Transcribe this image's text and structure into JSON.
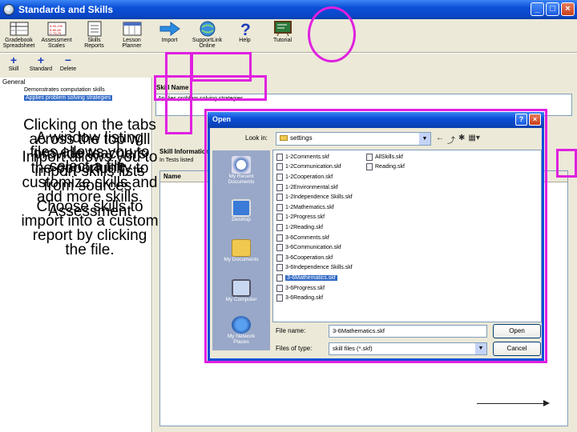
{
  "window": {
    "title": "Standards and Skills",
    "min": "_",
    "max": "□",
    "close": "×"
  },
  "toolbar": [
    {
      "label": "Gradebook\nSpreadsheet",
      "icon": "gradebook-icon"
    },
    {
      "label": "Assessment\nScales",
      "icon": "scales-icon"
    },
    {
      "label": "Skills\nReports",
      "icon": "reports-icon"
    },
    {
      "label": "Lesson\nPlanner",
      "icon": "planner-icon"
    },
    {
      "label": "Import",
      "icon": "import-arrow-icon"
    },
    {
      "label": "SupportLink\nOnline",
      "icon": "globe-icon"
    },
    {
      "label": "Help",
      "icon": "help-icon"
    },
    {
      "label": "Tutorial",
      "icon": "tutorial-icon"
    }
  ],
  "subbar": [
    {
      "symbol": "+",
      "label": "Skill"
    },
    {
      "symbol": "+",
      "label": "Standard"
    },
    {
      "symbol": "−",
      "label": "Delete"
    }
  ],
  "left": {
    "group": "General",
    "items": [
      "Demonstrates computation skills",
      "Applies problem solving strategies"
    ]
  },
  "detail": {
    "skill_name_label": "Skill Name",
    "skill_name_value": "Applies problem solving strategies",
    "skill_info_label": "Skill Information",
    "tests_label": "In Tests listed",
    "grid_header": "Name"
  },
  "dialog": {
    "title": "Open",
    "look_in_label": "Look in:",
    "look_in_value": "settings",
    "places": [
      "My Recent\nDocuments",
      "Desktop",
      "My Documents",
      "My Computer",
      "My Network\nPlaces"
    ],
    "files_col1": [
      "1-2Comments.skf",
      "1-2Communication.skf",
      "1-2Cooperation.skf",
      "1-2Environmental.skf",
      "1-2Independence Skills.skf",
      "1-2Mathematics.skf",
      "1-2Progress.skf",
      "1-2Reading.skf",
      "3-6Comments.skf",
      "3-6Communication.skf",
      "3-6Cooperation.skf",
      "3-6Independence Skills.skf",
      "3-6Mathematics.skf",
      "3-6Progress.skf",
      "3-6Reading.skf"
    ],
    "files_col2": [
      "AllSkills.skf",
      "Reading.skf"
    ],
    "selected_file": "3-6Mathematics.skf",
    "file_name_label": "File name:",
    "file_name_value": "3-6Mathematics.skf",
    "file_type_label": "Files of type:",
    "file_type_value": "skill files (*.skf)",
    "open_button": "Open",
    "cancel_button": "Cancel"
  },
  "caption": [
    "Clicking on the tabs across the top will provide teachers the opportunity to customize skills and add more skills. Assessment",
    "A window listing files allows you to select a file.",
    "Import allows you to import skills lists from sources.",
    "Choose skills to import into a custom report by clicking the file."
  ],
  "colors": {
    "highlight": "#e020e0",
    "xp_blue": "#0a4fd8",
    "selection": "#316ac5"
  }
}
